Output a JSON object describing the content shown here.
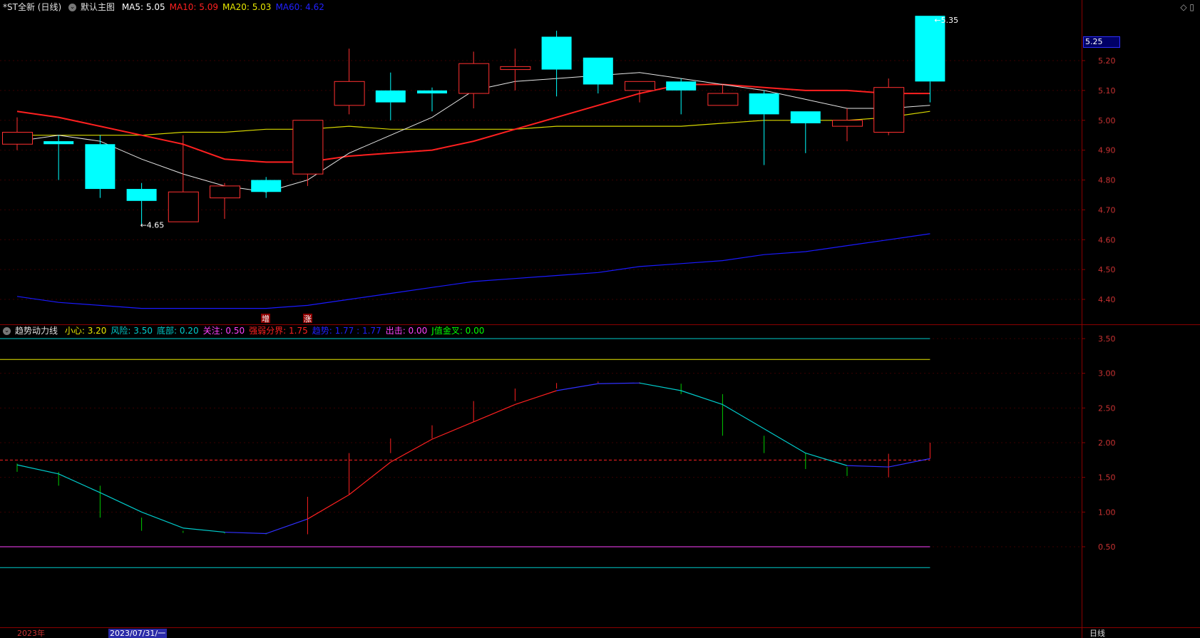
{
  "header": {
    "stock": "*ST全新 (日线)",
    "main_chart": "默认主图",
    "ma": [
      {
        "label": "MA5: 5.05",
        "color": "#ffffff"
      },
      {
        "label": "MA10: 5.09",
        "color": "#ff2020"
      },
      {
        "label": "MA20: 5.03",
        "color": "#e8e800"
      },
      {
        "label": "MA60: 4.62",
        "color": "#2020ff"
      }
    ]
  },
  "price_label": "5.25",
  "indicator_header": {
    "name": "趋势动力线",
    "items": [
      {
        "label": "小心: 3.20",
        "color": "#e8e800"
      },
      {
        "label": "风险: 3.50",
        "color": "#00cccc"
      },
      {
        "label": "底部: 0.20",
        "color": "#00cccc"
      },
      {
        "label": "关注: 0.50",
        "color": "#ff40ff"
      },
      {
        "label": "强弱分界: 1.75",
        "color": "#ff2020"
      },
      {
        "label": "趋势: 1.77 : 1.77",
        "color": "#2020ff"
      },
      {
        "label": "出击: 0.00",
        "color": "#ff40ff"
      },
      {
        "label": "J值金叉: 0.00",
        "color": "#00ff00"
      }
    ]
  },
  "footer": {
    "year": "2023年",
    "cursor_date": "2023/07/31/一",
    "period": "日线"
  },
  "markers": {
    "high": "5.35",
    "low": "4.65",
    "signal1": "增",
    "signal2": "涨"
  },
  "chart_data": [
    {
      "type": "candlestick",
      "ylim": [
        4.35,
        5.4
      ],
      "yticks": [
        "5.20",
        "5.10",
        "5.00",
        "4.90",
        "4.80",
        "4.70",
        "4.60",
        "4.50",
        "4.40"
      ],
      "candles": [
        {
          "o": 4.92,
          "h": 5.01,
          "l": 4.9,
          "c": 4.96
        },
        {
          "o": 4.93,
          "h": 4.95,
          "l": 4.8,
          "c": 4.92
        },
        {
          "o": 4.92,
          "h": 4.95,
          "l": 4.74,
          "c": 4.77
        },
        {
          "o": 4.77,
          "h": 4.79,
          "l": 4.65,
          "c": 4.73
        },
        {
          "o": 4.66,
          "h": 4.95,
          "l": 4.66,
          "c": 4.76
        },
        {
          "o": 4.74,
          "h": 4.79,
          "l": 4.67,
          "c": 4.78
        },
        {
          "o": 4.8,
          "h": 4.81,
          "l": 4.74,
          "c": 4.76
        },
        {
          "o": 4.82,
          "h": 5.0,
          "l": 4.78,
          "c": 5.0
        },
        {
          "o": 5.05,
          "h": 5.24,
          "l": 5.02,
          "c": 5.13
        },
        {
          "o": 5.1,
          "h": 5.16,
          "l": 5.0,
          "c": 5.06
        },
        {
          "o": 5.1,
          "h": 5.11,
          "l": 5.03,
          "c": 5.09
        },
        {
          "o": 5.09,
          "h": 5.23,
          "l": 5.04,
          "c": 5.19
        },
        {
          "o": 5.17,
          "h": 5.24,
          "l": 5.1,
          "c": 5.18
        },
        {
          "o": 5.28,
          "h": 5.3,
          "l": 5.08,
          "c": 5.17
        },
        {
          "o": 5.21,
          "h": 5.21,
          "l": 5.09,
          "c": 5.12
        },
        {
          "o": 5.1,
          "h": 5.13,
          "l": 5.06,
          "c": 5.13
        },
        {
          "o": 5.13,
          "h": 5.14,
          "l": 5.02,
          "c": 5.1
        },
        {
          "o": 5.05,
          "h": 5.12,
          "l": 5.05,
          "c": 5.09
        },
        {
          "o": 5.09,
          "h": 5.1,
          "l": 4.85,
          "c": 5.02
        },
        {
          "o": 5.03,
          "h": 5.03,
          "l": 4.89,
          "c": 4.99
        },
        {
          "o": 4.98,
          "h": 5.04,
          "l": 4.93,
          "c": 5.0
        },
        {
          "o": 4.96,
          "h": 5.14,
          "l": 4.95,
          "c": 5.11
        },
        {
          "o": 5.35,
          "h": 5.35,
          "l": 5.06,
          "c": 5.13
        }
      ],
      "ma5": [
        4.93,
        4.95,
        4.93,
        4.87,
        4.82,
        4.78,
        4.76,
        4.8,
        4.89,
        4.95,
        5.01,
        5.1,
        5.13,
        5.14,
        5.15,
        5.16,
        5.14,
        5.12,
        5.1,
        5.07,
        5.04,
        5.04,
        5.05
      ],
      "ma10": [
        5.03,
        5.01,
        4.98,
        4.95,
        4.92,
        4.87,
        4.86,
        4.86,
        4.88,
        4.89,
        4.9,
        4.93,
        4.97,
        5.01,
        5.05,
        5.09,
        5.12,
        5.12,
        5.11,
        5.1,
        5.1,
        5.09,
        5.09
      ],
      "ma20": [
        4.95,
        4.95,
        4.95,
        4.95,
        4.96,
        4.96,
        4.97,
        4.97,
        4.98,
        4.97,
        4.97,
        4.97,
        4.97,
        4.98,
        4.98,
        4.98,
        4.98,
        4.99,
        5.0,
        5.0,
        5.0,
        5.01,
        5.03
      ],
      "ma60": [
        4.41,
        4.39,
        4.38,
        4.37,
        4.37,
        4.37,
        4.37,
        4.38,
        4.4,
        4.42,
        4.44,
        4.46,
        4.47,
        4.48,
        4.49,
        4.51,
        4.52,
        4.53,
        4.55,
        4.56,
        4.58,
        4.6,
        4.62
      ]
    },
    {
      "type": "line",
      "title": "趋势动力线",
      "ylim": [
        0.2,
        3.6
      ],
      "yticks": [
        "3.50",
        "3.00",
        "2.50",
        "2.00",
        "1.50",
        "1.00",
        "0.50"
      ],
      "levels": [
        {
          "name": "风险",
          "value": 3.5,
          "color": "#00cccc"
        },
        {
          "name": "小心",
          "value": 3.2,
          "color": "#e8e800"
        },
        {
          "name": "强弱分界",
          "value": 1.75,
          "color": "#ff2020",
          "dashed": true
        },
        {
          "name": "关注",
          "value": 0.5,
          "color": "#ff40ff"
        },
        {
          "name": "底部",
          "value": 0.2,
          "color": "#00cccc"
        }
      ],
      "trend": [
        1.68,
        1.55,
        1.28,
        1.0,
        0.77,
        0.71,
        0.69,
        0.9,
        1.25,
        1.72,
        2.05,
        2.3,
        2.55,
        2.75,
        2.85,
        2.86,
        2.75,
        2.55,
        2.2,
        1.85,
        1.67,
        1.65,
        1.77
      ],
      "bars": [
        {
          "a": 1.58,
          "b": 1.7,
          "c": "#00cc00"
        },
        {
          "a": 1.38,
          "b": 1.58,
          "c": "#00cc00"
        },
        {
          "a": 0.92,
          "b": 1.38,
          "c": "#00cc00"
        },
        {
          "a": 0.73,
          "b": 0.92,
          "c": "#00cc00"
        },
        {
          "a": 0.7,
          "b": 0.73,
          "c": "#00cc00"
        },
        {
          "a": 0.69,
          "b": 0.71,
          "c": "#00cc00"
        },
        {
          "a": 0.68,
          "b": 0.7,
          "c": "#00cc00"
        },
        {
          "a": 0.68,
          "b": 1.22,
          "c": "#ff2020"
        },
        {
          "a": 1.25,
          "b": 1.85,
          "c": "#ff2020"
        },
        {
          "a": 1.85,
          "b": 2.06,
          "c": "#ff2020"
        },
        {
          "a": 2.06,
          "b": 2.25,
          "c": "#ff2020"
        },
        {
          "a": 2.3,
          "b": 2.6,
          "c": "#ff2020"
        },
        {
          "a": 2.6,
          "b": 2.78,
          "c": "#ff2020"
        },
        {
          "a": 2.78,
          "b": 2.86,
          "c": "#ff2020"
        },
        {
          "a": 2.86,
          "b": 2.88,
          "c": "#ff2020"
        },
        {
          "a": 2.85,
          "b": 2.87,
          "c": "#ff2020"
        },
        {
          "a": 2.7,
          "b": 2.85,
          "c": "#00cc00"
        },
        {
          "a": 2.1,
          "b": 2.7,
          "c": "#00cc00"
        },
        {
          "a": 1.85,
          "b": 2.1,
          "c": "#00cc00"
        },
        {
          "a": 1.62,
          "b": 1.85,
          "c": "#00cc00"
        },
        {
          "a": 1.52,
          "b": 1.65,
          "c": "#00cc00"
        },
        {
          "a": 1.5,
          "b": 1.84,
          "c": "#ff2020"
        },
        {
          "a": 1.77,
          "b": 2.0,
          "c": "#ff2020"
        }
      ]
    }
  ]
}
